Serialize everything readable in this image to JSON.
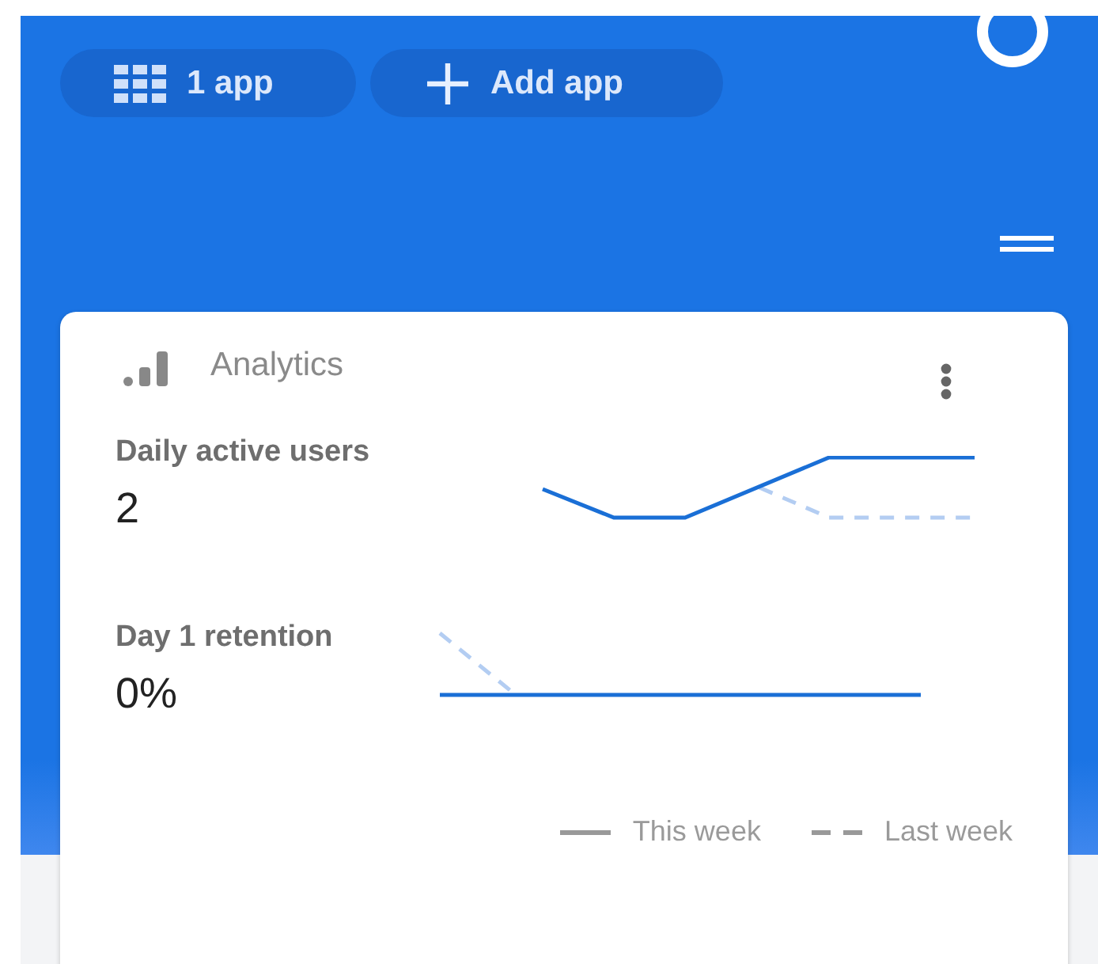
{
  "header": {
    "chips": [
      {
        "kind": "apps",
        "label": "1 app"
      },
      {
        "kind": "add",
        "label": "Add app"
      }
    ]
  },
  "card": {
    "title": "Analytics",
    "metrics": [
      {
        "label": "Daily active users",
        "value": "2"
      },
      {
        "label": "Day 1 retention",
        "value": "0%"
      }
    ],
    "legend": [
      {
        "kind": "solid",
        "label": "This week"
      },
      {
        "kind": "dashed",
        "label": "Last week"
      }
    ]
  }
}
